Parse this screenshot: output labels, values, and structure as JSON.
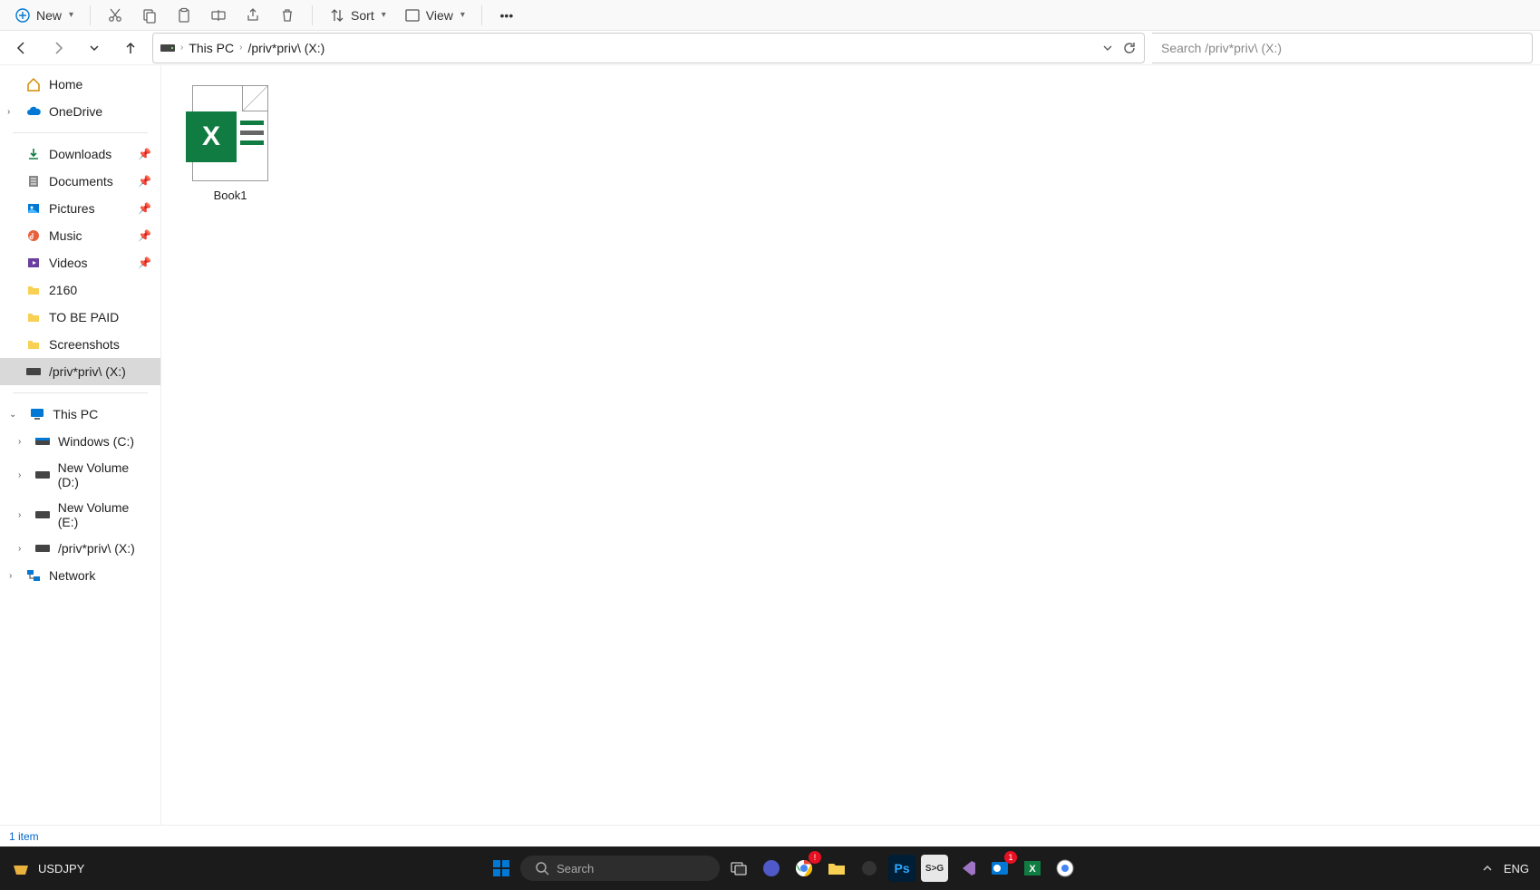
{
  "toolbar": {
    "new_label": "New",
    "sort_label": "Sort",
    "view_label": "View"
  },
  "address": {
    "root": "This PC",
    "path": "/priv*priv\\ (X:)"
  },
  "search": {
    "placeholder": "Search /priv*priv\\ (X:)"
  },
  "sidebar": {
    "home": "Home",
    "onedrive": "OneDrive",
    "quick": [
      {
        "label": "Downloads",
        "pinned": true
      },
      {
        "label": "Documents",
        "pinned": true
      },
      {
        "label": "Pictures",
        "pinned": true
      },
      {
        "label": "Music",
        "pinned": true
      },
      {
        "label": "Videos",
        "pinned": true
      },
      {
        "label": "2160",
        "pinned": false
      },
      {
        "label": "TO BE PAID",
        "pinned": false
      },
      {
        "label": "Screenshots",
        "pinned": false
      },
      {
        "label": "/priv*priv\\ (X:)",
        "pinned": false
      }
    ],
    "thispc": "This PC",
    "drives": [
      {
        "label": "Windows (C:)"
      },
      {
        "label": "New Volume (D:)"
      },
      {
        "label": "New Volume (E:)"
      },
      {
        "label": "/priv*priv\\ (X:)"
      }
    ],
    "network": "Network"
  },
  "files": [
    {
      "name": "Book1",
      "type": "excel"
    }
  ],
  "status": {
    "count": "1 item"
  },
  "taskbar": {
    "widget": "USDJPY",
    "search": "Search",
    "lang": "ENG"
  }
}
